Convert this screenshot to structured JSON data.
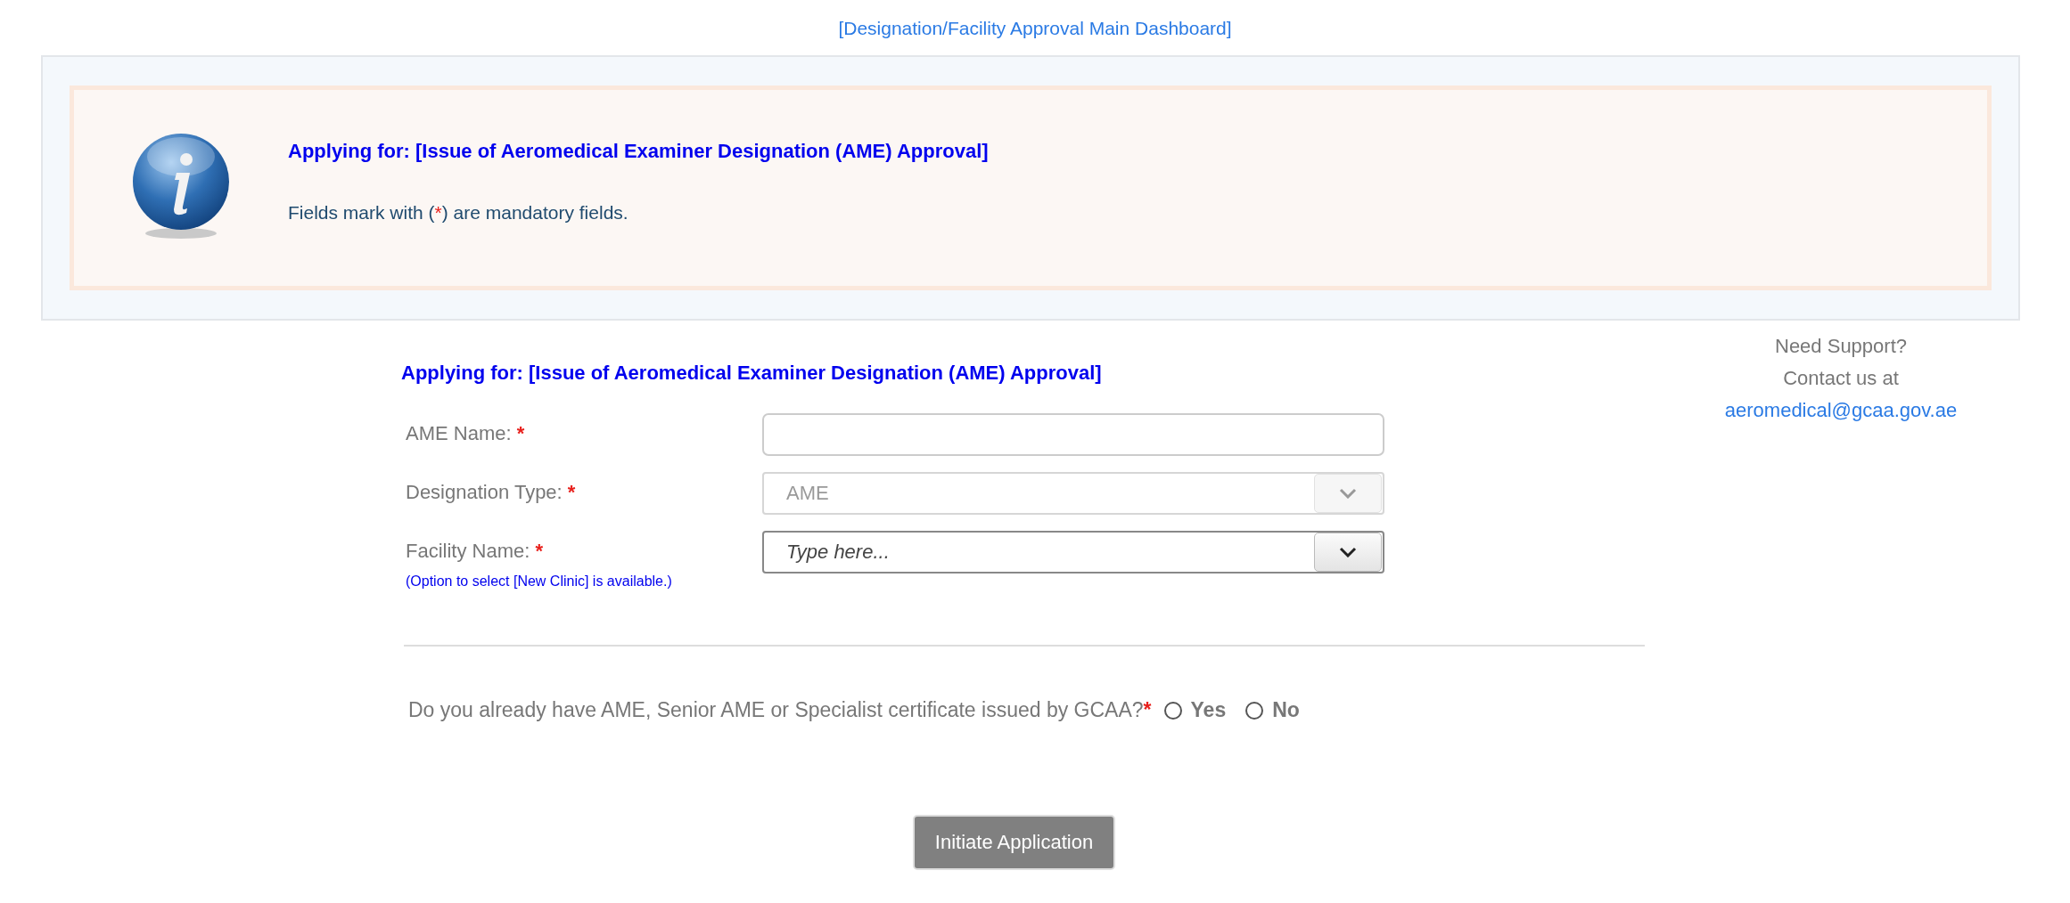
{
  "dashboard_link": "[Designation/Facility Approval Main Dashboard]",
  "info_panel": {
    "heading": "Applying for: [Issue of Aeromedical Examiner Designation (AME) Approval]",
    "note": [
      {
        "kind": "plain",
        "text": "Fields mark with ("
      },
      {
        "kind": "required",
        "text": "*"
      },
      {
        "kind": "plain",
        "text": ") are mandatory fields."
      }
    ]
  },
  "form": {
    "heading": "Applying for: [Issue of Aeromedical Examiner Designation (AME) Approval]",
    "fields": [
      {
        "kind": "text",
        "label": "AME Name:",
        "required_mark": "*"
      },
      {
        "kind": "select",
        "label": "Designation Type:",
        "required_mark": "*",
        "value": "AME",
        "disabled": true
      },
      {
        "kind": "select",
        "label": "Facility Name:",
        "required_mark": "*",
        "placeholder": "Type here...",
        "hint": "(Option to select [New Clinic] is available.)",
        "disabled": false
      }
    ],
    "question": {
      "text": "Do you already have AME, Senior AME or Specialist certificate issued by GCAA?",
      "required_mark": "*",
      "options": [
        {
          "label": "Yes",
          "selected": false
        },
        {
          "label": "No",
          "selected": false
        }
      ]
    },
    "submit_button": "Initiate Application"
  },
  "support": {
    "lines": [
      "Need Support?",
      "Contact us at"
    ],
    "email": "aeromedical@gcaa.gov.ae"
  }
}
